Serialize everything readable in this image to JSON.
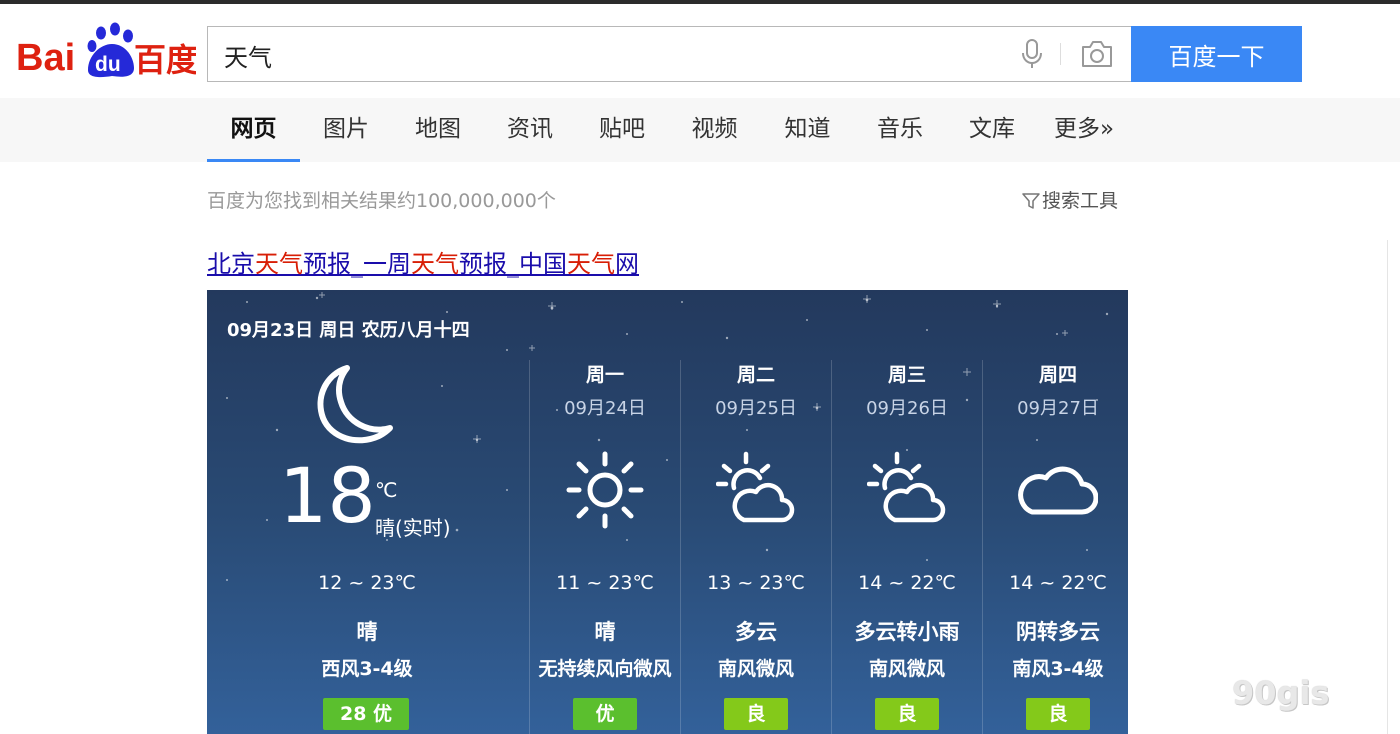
{
  "header": {
    "logo_text": "Bai du 百度",
    "search_value": "天气",
    "search_button": "百度一下"
  },
  "tabs": [
    {
      "label": "网页",
      "active": true
    },
    {
      "label": "图片"
    },
    {
      "label": "地图"
    },
    {
      "label": "资讯"
    },
    {
      "label": "贴吧"
    },
    {
      "label": "视频"
    },
    {
      "label": "知道"
    },
    {
      "label": "音乐"
    },
    {
      "label": "文库"
    },
    {
      "label": "更多»"
    }
  ],
  "results": {
    "count_text": "百度为您找到相关结果约100,000,000个",
    "tools_label": "搜索工具"
  },
  "result": {
    "title_parts": [
      "北京",
      "天气",
      "预报_一周",
      "天气",
      "预报_中国",
      "天气",
      "网"
    ]
  },
  "weather": {
    "today": {
      "date_text": "09月23日 周日 农历八月十四",
      "icon": "moon-icon",
      "temp": "18",
      "unit": "℃",
      "condition_now": "晴(实时)",
      "range": "12 ~ 23℃",
      "condition": "晴",
      "wind": "西风3-4级",
      "aqi": "28 优"
    },
    "forecast": [
      {
        "day": "周一",
        "date": "09月24日",
        "icon": "sun-icon",
        "range": "11 ~ 23℃",
        "condition": "晴",
        "wind": "无持续风向微风",
        "aqi": "优"
      },
      {
        "day": "周二",
        "date": "09月25日",
        "icon": "partly-cloudy-icon",
        "range": "13 ~ 23℃",
        "condition": "多云",
        "wind": "南风微风",
        "aqi": "良"
      },
      {
        "day": "周三",
        "date": "09月26日",
        "icon": "partly-cloudy-icon",
        "range": "14 ~ 22℃",
        "condition": "多云转小雨",
        "wind": "南风微风",
        "aqi": "良"
      },
      {
        "day": "周四",
        "date": "09月27日",
        "icon": "cloud-icon",
        "range": "14 ~ 22℃",
        "condition": "阴转多云",
        "wind": "南风3-4级",
        "aqi": "良"
      }
    ]
  },
  "watermark": "90gis",
  "colors": {
    "accent": "#3a88f5",
    "aqi_good": "#5bbf2e",
    "aqi_fair": "#84c91a",
    "link": "#1a0dab",
    "highlight": "#d81e06"
  }
}
